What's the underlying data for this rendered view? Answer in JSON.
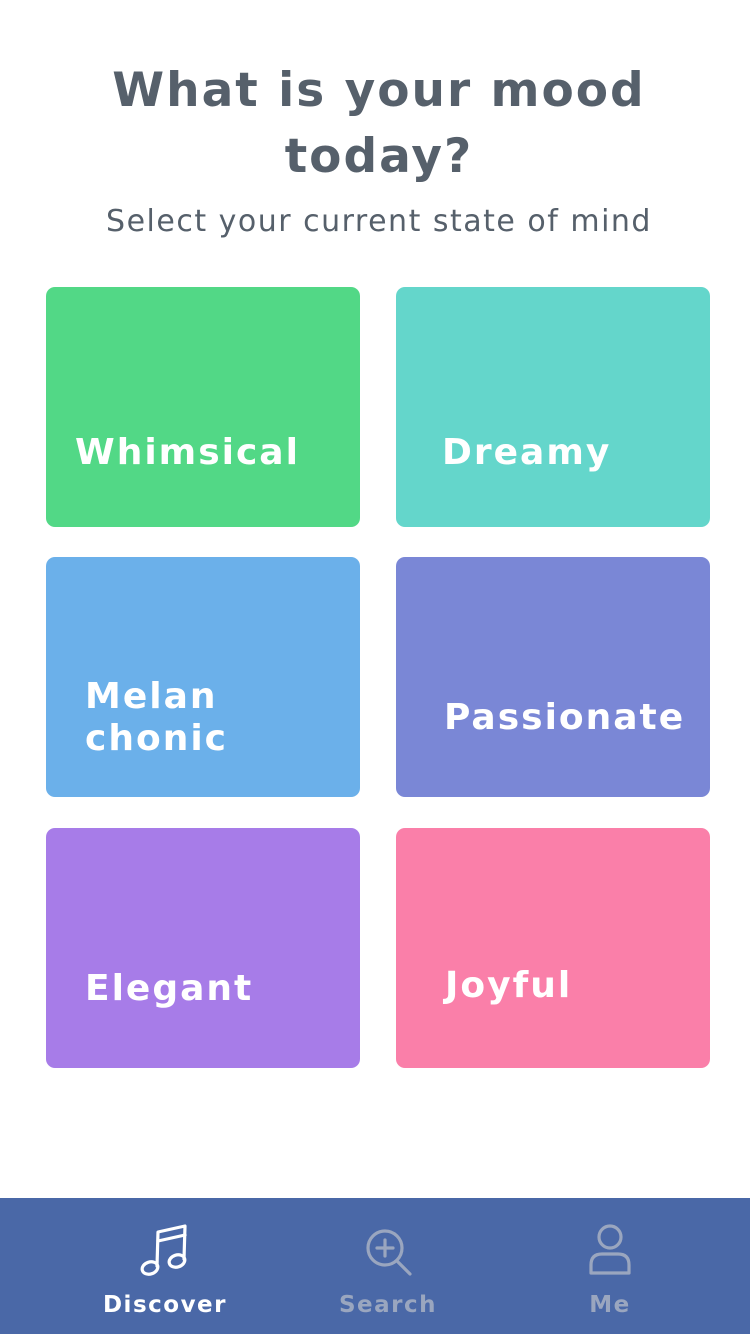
{
  "header": {
    "title": "What is your mood today?",
    "subtitle": "Select your current state of mind"
  },
  "moods": [
    {
      "label": "Whimsical",
      "color": "#52d886"
    },
    {
      "label": "Dreamy",
      "color": "#64d6cb"
    },
    {
      "label": "Melan\nchonic",
      "color": "#6bb0ea"
    },
    {
      "label": "Passionate",
      "color": "#7a87d6"
    },
    {
      "label": "Elegant",
      "color": "#a77ce8"
    },
    {
      "label": "Joyful",
      "color": "#fa7fa9"
    }
  ],
  "tab_bar": {
    "background": "#4a68a7",
    "tabs": [
      {
        "label": "Discover",
        "icon": "music-note-icon",
        "active": true
      },
      {
        "label": "Search",
        "icon": "search-icon",
        "active": false
      },
      {
        "label": "Me",
        "icon": "person-icon",
        "active": false
      }
    ]
  }
}
